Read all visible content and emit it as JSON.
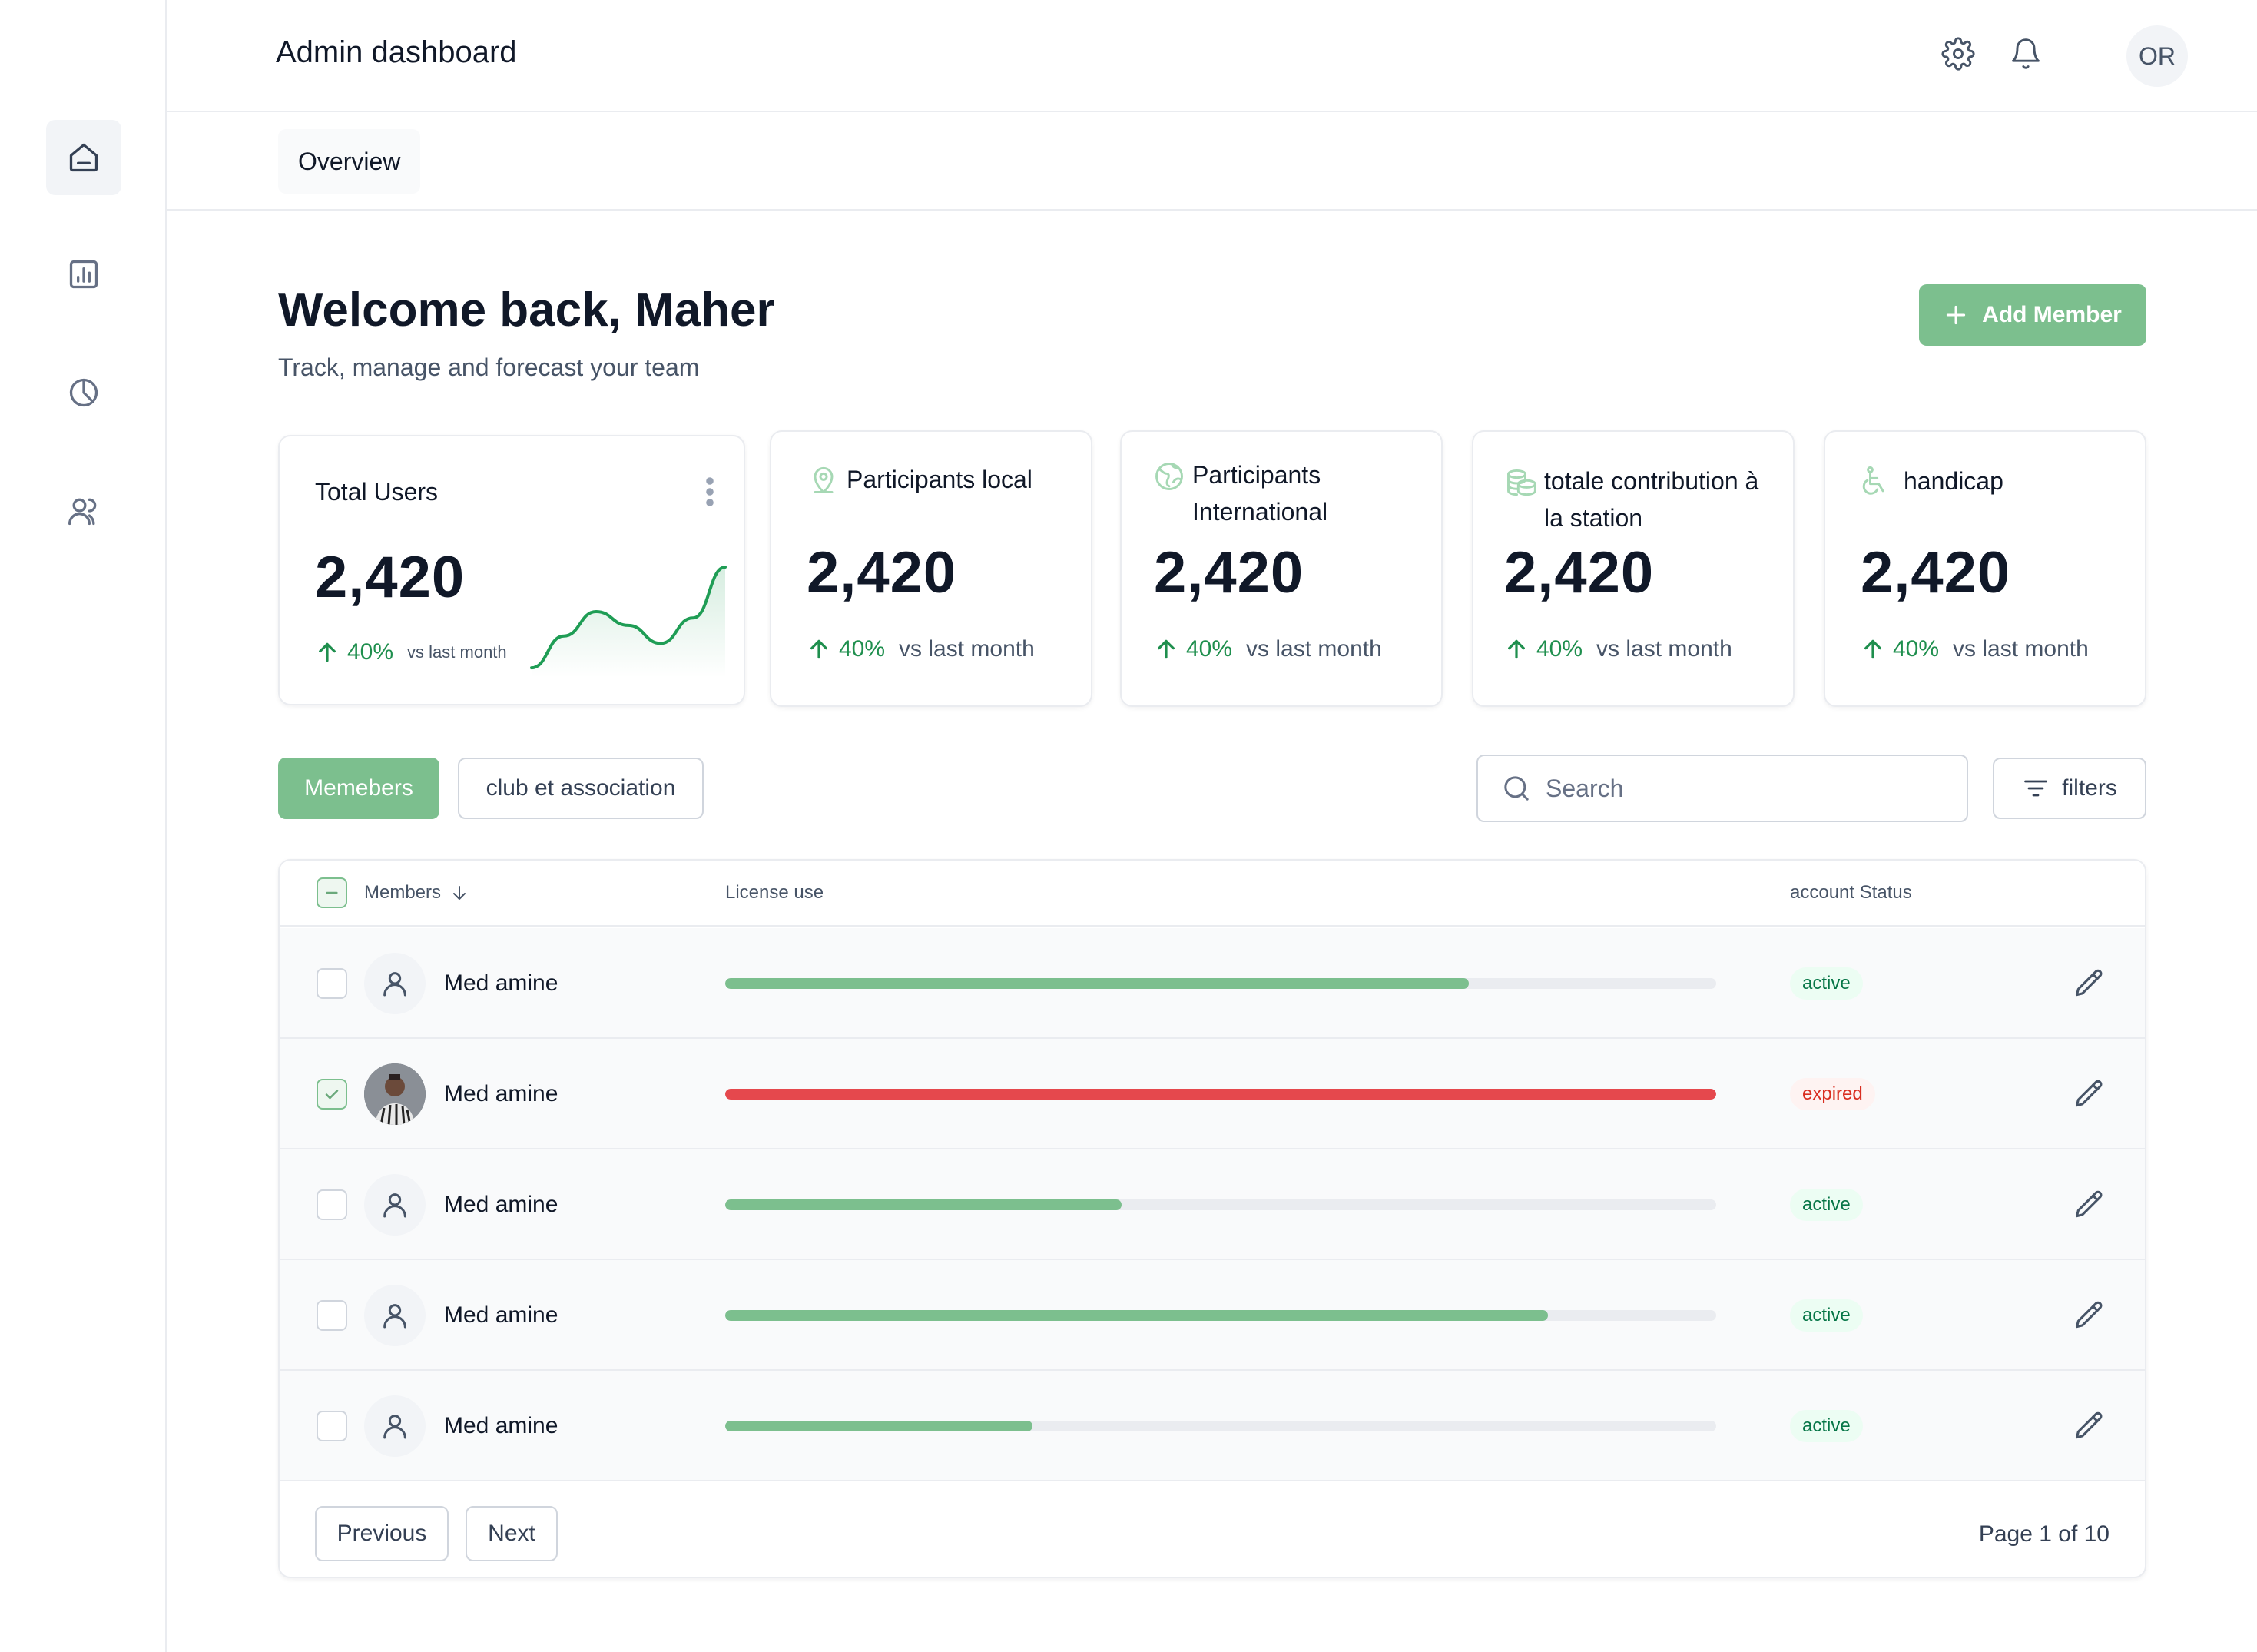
{
  "header": {
    "title": "Admin dashboard",
    "user_initials": "OR"
  },
  "sidebar": {
    "items": [
      {
        "icon": "home-icon",
        "active": true
      },
      {
        "icon": "bar-chart-icon",
        "active": false
      },
      {
        "icon": "pie-chart-icon",
        "active": false
      },
      {
        "icon": "users-icon",
        "active": false
      }
    ]
  },
  "tabs": {
    "overview": "Overview"
  },
  "main": {
    "welcome": "Welcome back, Maher",
    "subtitle": "Track, manage and forecast your team",
    "add_member_label": "Add Member"
  },
  "stats": [
    {
      "title": "Total Users",
      "value": "2,420",
      "change": "40%",
      "compare": "vs last month",
      "icon": "kebab-menu-icon",
      "sparkline": [
        0.05,
        0.35,
        0.58,
        0.45,
        0.28,
        0.52,
        1.0
      ]
    },
    {
      "title": "Participants local",
      "value": "2,420",
      "change": "40%",
      "compare": "vs last month",
      "icon": "location-pin-icon"
    },
    {
      "title": "Participants International",
      "value": "2,420",
      "change": "40%",
      "compare": "vs last month",
      "icon": "globe-icon"
    },
    {
      "title": "totale contribution à la station",
      "value": "2,420",
      "change": "40%",
      "compare": "vs last month",
      "icon": "coins-icon"
    },
    {
      "title": "handicap",
      "value": "2,420",
      "change": "40%",
      "compare": "vs last month",
      "icon": "wheelchair-icon"
    }
  ],
  "filters": {
    "segment_active": "Memebers",
    "segment_other": "club et association",
    "search_placeholder": "Search",
    "filters_label": "filters"
  },
  "table": {
    "columns": {
      "members": "Members",
      "license": "License use",
      "status": "account Status"
    },
    "rows": [
      {
        "name": "Med amine",
        "license_use": 0.75,
        "status": "active",
        "checked": false,
        "photo": false
      },
      {
        "name": "Med amine",
        "license_use": 1.0,
        "status": "expired",
        "checked": true,
        "photo": true
      },
      {
        "name": "Med amine",
        "license_use": 0.4,
        "status": "active",
        "checked": false,
        "photo": false
      },
      {
        "name": "Med amine",
        "license_use": 0.83,
        "status": "active",
        "checked": false,
        "photo": false
      },
      {
        "name": "Med amine",
        "license_use": 0.31,
        "status": "active",
        "checked": false,
        "photo": false
      }
    ],
    "pagination": {
      "previous": "Previous",
      "next": "Next",
      "page_info": "Page 1 of 10"
    }
  },
  "colors": {
    "accent": "#7cbf8e",
    "bar_good": "#7cbf8e",
    "bar_expired": "#e5484d",
    "trend_up": "#1f8f4e"
  }
}
